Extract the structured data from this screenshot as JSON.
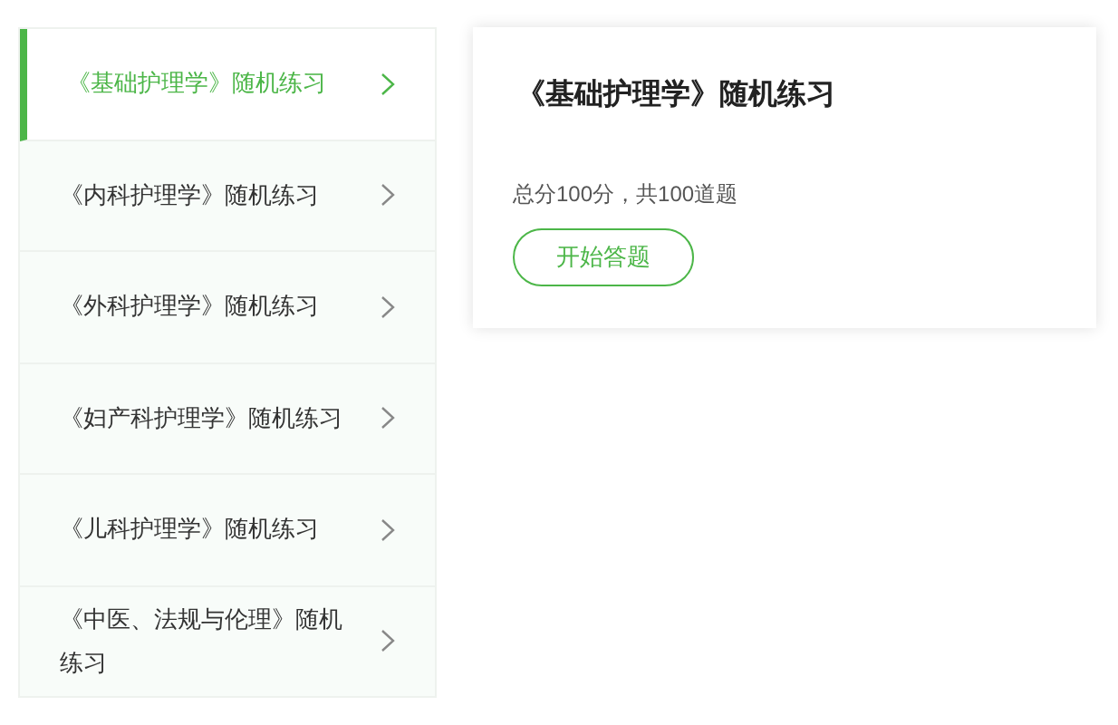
{
  "sidebar": {
    "items": [
      {
        "label": "《基础护理学》随机练习",
        "selected": true
      },
      {
        "label": "《内科护理学》随机练习",
        "selected": false
      },
      {
        "label": "《外科护理学》随机练习",
        "selected": false
      },
      {
        "label": "《妇产科护理学》随机练习",
        "selected": false
      },
      {
        "label": "《儿科护理学》随机练习",
        "selected": false
      },
      {
        "label": "《中医、法规与伦理》随机练习",
        "selected": false
      }
    ]
  },
  "card": {
    "title": "《基础护理学》随机练习",
    "summary": "总分100分，共100道题",
    "button": "开始答题"
  }
}
